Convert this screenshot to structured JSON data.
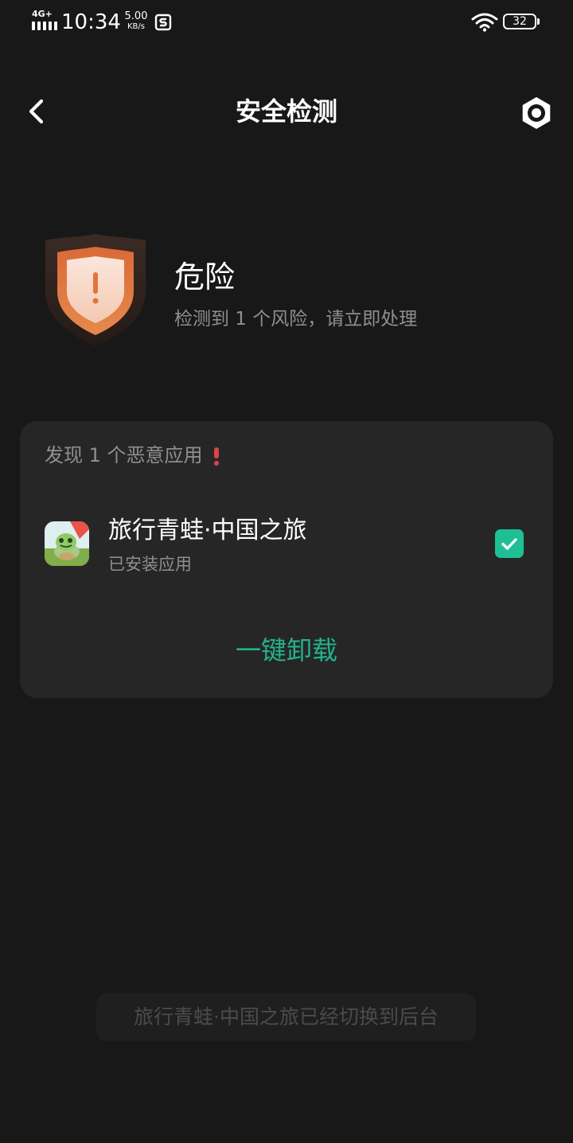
{
  "status_bar": {
    "network": "4G+",
    "time": "10:34",
    "speed_value": "5.00",
    "speed_unit": "KB/s",
    "battery": "32",
    "icons": [
      "signal-icon",
      "app-status-icon",
      "wifi-icon",
      "battery-icon"
    ]
  },
  "header": {
    "title": "安全检测",
    "back_icon": "chevron-left-icon",
    "settings_icon": "settings-icon"
  },
  "summary": {
    "icon": "shield-warning-icon",
    "status": "危险",
    "description": "检测到 1 个风险，请立即处理"
  },
  "card": {
    "header": "发现 1 个恶意应用",
    "alert_icon": "exclamation-icon",
    "apps": [
      {
        "name": "旅行青蛙·中国之旅",
        "sub": "已安装应用",
        "checked": true
      }
    ],
    "action": "一键卸载"
  },
  "toast": "旅行青蛙·中国之旅已经切换到后台",
  "colors": {
    "background": "#181818",
    "card": "#262626",
    "accent": "#1fbf96",
    "danger": "#e0424b",
    "shield": "#e2743f"
  }
}
